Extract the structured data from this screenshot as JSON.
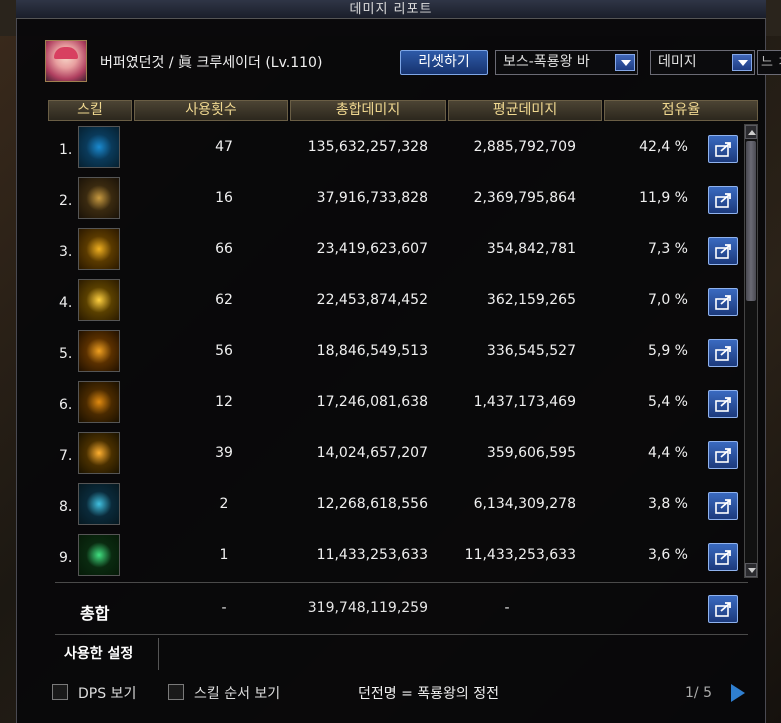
{
  "window": {
    "title": "데미지 리포트"
  },
  "character": {
    "name": "버퍼였던것 / 眞 크루세이더 (Lv.110)"
  },
  "toolbar": {
    "reset_label": "리셋하기",
    "dungeon_select_value": "보스-폭룡왕 바",
    "metric_select_value": "데미지",
    "extra_select_stub": "느 ㅈ"
  },
  "columns": {
    "skill": "스킬",
    "uses": "사용횟수",
    "total": "총합데미지",
    "average": "평균데미지",
    "share": "점유율"
  },
  "rows": [
    {
      "rank": "1.",
      "uses": "47",
      "total": "135,632,257,328",
      "average": "2,885,792,709",
      "share": "42,4 %",
      "icon": "light-pillar-skill-icon",
      "colors": [
        "#0a3a5a",
        "#1a8ad0",
        "#062030"
      ]
    },
    {
      "rank": "2.",
      "uses": "16",
      "total": "37,916,733,828",
      "average": "2,369,795,864",
      "share": "11,9 %",
      "icon": "holy-seal-skill-icon",
      "colors": [
        "#3a2a10",
        "#c89a40",
        "#1a1208"
      ]
    },
    {
      "rank": "3.",
      "uses": "66",
      "total": "23,419,623,607",
      "average": "354,842,781",
      "share": "7,3 %",
      "icon": "holy-cross-skill-icon",
      "colors": [
        "#5a3a00",
        "#f0b020",
        "#2a1800"
      ]
    },
    {
      "rank": "4.",
      "uses": "62",
      "total": "22,453,874,452",
      "average": "362,159,265",
      "share": "7,0 %",
      "icon": "radiant-burst-skill-icon",
      "colors": [
        "#5a4000",
        "#ffd040",
        "#2a1a00"
      ]
    },
    {
      "rank": "5.",
      "uses": "56",
      "total": "18,846,549,513",
      "average": "336,545,527",
      "share": "5,9 %",
      "icon": "light-wall-skill-icon",
      "colors": [
        "#5a3000",
        "#f0a020",
        "#201000"
      ]
    },
    {
      "rank": "6.",
      "uses": "12",
      "total": "17,246,081,638",
      "average": "1,437,173,469",
      "share": "5,4 %",
      "icon": "smite-skill-icon",
      "colors": [
        "#4a2a00",
        "#e08a10",
        "#1a1000"
      ]
    },
    {
      "rank": "7.",
      "uses": "39",
      "total": "14,024,657,207",
      "average": "359,606,595",
      "share": "4,4 %",
      "icon": "blessing-cog-skill-icon",
      "colors": [
        "#4a3000",
        "#ffb030",
        "#1a1200"
      ]
    },
    {
      "rank": "8.",
      "uses": "2",
      "total": "12,268,618,556",
      "average": "6,134,309,278",
      "share": "3,8 %",
      "icon": "lightning-skill-icon",
      "colors": [
        "#0a2a3a",
        "#40c0e0",
        "#061820"
      ]
    },
    {
      "rank": "9.",
      "uses": "1",
      "total": "11,433,253,633",
      "average": "11,433,253,633",
      "share": "3,6 %",
      "icon": "green-burst-skill-icon",
      "colors": [
        "#0a2a10",
        "#40e080",
        "#061a08"
      ]
    }
  ],
  "total": {
    "label": "총합",
    "uses": "-",
    "total": "319,748,119,259",
    "average": "-"
  },
  "settings_tab": "사용한 설정",
  "footer": {
    "dps_label": "DPS 보기",
    "skill_order_label": "스킬 순서 보기",
    "dungeon_info": "던전명 = 폭룡왕의 정전",
    "page": "1/ 5"
  }
}
